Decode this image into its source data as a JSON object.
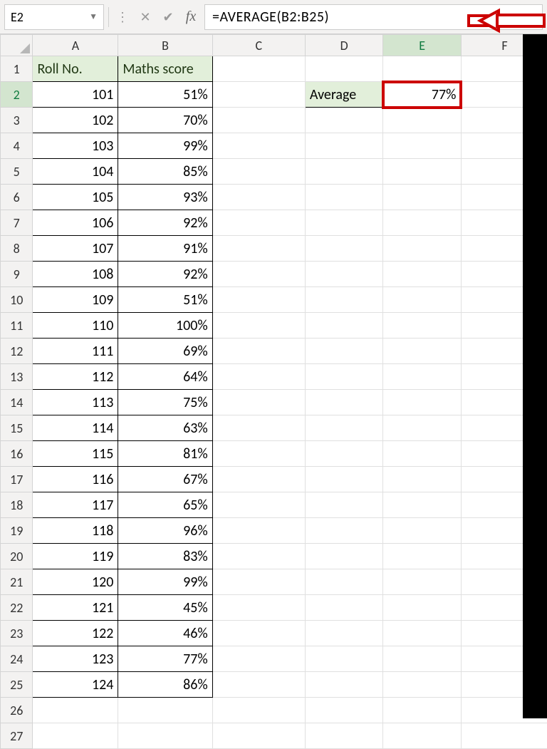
{
  "formula_bar": {
    "name_box": "E2",
    "formula": "=AVERAGE(B2:B25)"
  },
  "columns": [
    "A",
    "B",
    "C",
    "D",
    "E",
    "F"
  ],
  "headers": {
    "A": "Roll No.",
    "B": "Maths score"
  },
  "rows": [
    {
      "n": 1
    },
    {
      "n": 2,
      "A": "101",
      "B": "51%",
      "D": "Average",
      "E": "77%"
    },
    {
      "n": 3,
      "A": "102",
      "B": "70%"
    },
    {
      "n": 4,
      "A": "103",
      "B": "99%"
    },
    {
      "n": 5,
      "A": "104",
      "B": "85%"
    },
    {
      "n": 6,
      "A": "105",
      "B": "93%"
    },
    {
      "n": 7,
      "A": "106",
      "B": "92%"
    },
    {
      "n": 8,
      "A": "107",
      "B": "91%"
    },
    {
      "n": 9,
      "A": "108",
      "B": "92%"
    },
    {
      "n": 10,
      "A": "109",
      "B": "51%"
    },
    {
      "n": 11,
      "A": "110",
      "B": "100%"
    },
    {
      "n": 12,
      "A": "111",
      "B": "69%"
    },
    {
      "n": 13,
      "A": "112",
      "B": "64%"
    },
    {
      "n": 14,
      "A": "113",
      "B": "75%"
    },
    {
      "n": 15,
      "A": "114",
      "B": "63%"
    },
    {
      "n": 16,
      "A": "115",
      "B": "81%"
    },
    {
      "n": 17,
      "A": "116",
      "B": "67%"
    },
    {
      "n": 18,
      "A": "117",
      "B": "65%"
    },
    {
      "n": 19,
      "A": "118",
      "B": "96%"
    },
    {
      "n": 20,
      "A": "119",
      "B": "83%"
    },
    {
      "n": 21,
      "A": "120",
      "B": "99%"
    },
    {
      "n": 22,
      "A": "121",
      "B": "45%"
    },
    {
      "n": 23,
      "A": "122",
      "B": "46%"
    },
    {
      "n": 24,
      "A": "123",
      "B": "77%"
    },
    {
      "n": 25,
      "A": "124",
      "B": "86%"
    },
    {
      "n": 26
    },
    {
      "n": 27
    }
  ],
  "selected": {
    "col": "E",
    "row": 2
  }
}
